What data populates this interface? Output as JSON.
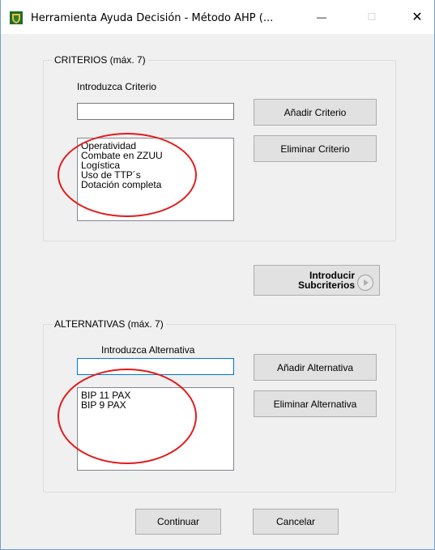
{
  "window": {
    "title": "Herramienta Ayuda Decisión - Método AHP (...",
    "minimize_glyph": "—",
    "maximize_glyph": "☐",
    "close_glyph": "✕"
  },
  "criterios": {
    "legend": "CRITERIOS (máx. 7)",
    "input_label": "Introduzca Criterio",
    "input_value": "",
    "add_button": "Añadir Criterio",
    "remove_button": "Eliminar Criterio",
    "items": [
      "Operatividad",
      "Combate en ZZUU",
      "Logística",
      "Uso de TTP´s",
      "Dotación completa"
    ]
  },
  "subcriterios_button": {
    "line1": "Introducir",
    "line2": "Subcriterios",
    "icon": "play-circle-icon"
  },
  "alternativas": {
    "legend": "ALTERNATIVAS (máx. 7)",
    "input_label": "Introduzca Alternativa",
    "input_value": "",
    "add_button": "Añadir Alternativa",
    "remove_button": "Eliminar Alternativa",
    "items": [
      "BIP 11 PAX",
      "BIP 9 PAX"
    ]
  },
  "footer": {
    "continue_button": "Continuar",
    "cancel_button": "Cancelar"
  },
  "colors": {
    "annotation": "#e21b1b",
    "focus_border": "#0078d7"
  }
}
